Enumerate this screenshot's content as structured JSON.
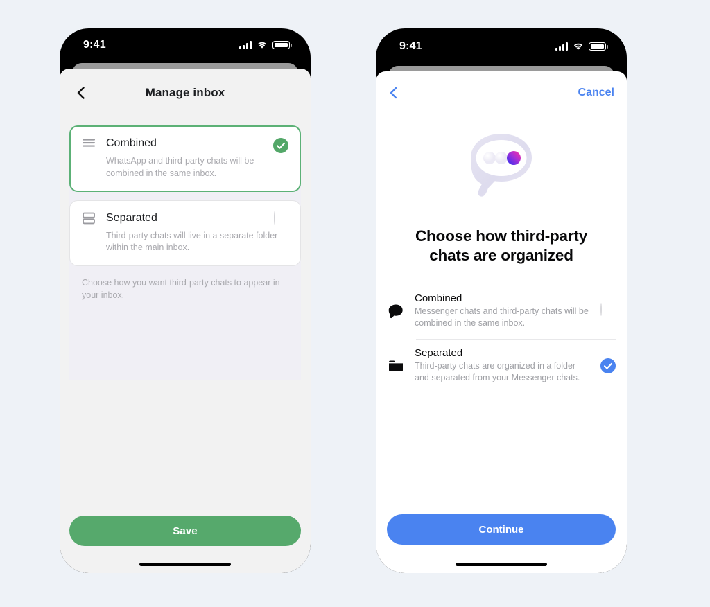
{
  "theme": {
    "page_bg": "#eef2f7",
    "green": "#56a96c",
    "green_border": "#5cb176",
    "blue": "#4a83f0",
    "muted_text": "#a9a9ae",
    "title_text": "#1c1e21"
  },
  "left_phone": {
    "status_bar": {
      "time": "9:41",
      "signal_icon": "cellular-bars-icon",
      "wifi_icon": "wifi-icon",
      "battery_icon": "battery-full-icon"
    },
    "nav": {
      "back_icon": "chevron-left-icon",
      "title": "Manage inbox"
    },
    "options": [
      {
        "icon": "list-lines-icon",
        "title": "Combined",
        "description": "WhatsApp and third-party chats will be combined in the same inbox.",
        "selected": true,
        "mark_icon": "check-circle-filled-icon"
      },
      {
        "icon": "stacked-boxes-icon",
        "title": "Separated",
        "description": "Third-party chats will live in a separate folder within the main inbox.",
        "selected": false,
        "mark_icon": "radio-empty-icon"
      }
    ],
    "helper_text": "Choose how you want third-party chats to appear in your inbox.",
    "primary_button": "Save",
    "home_indicator": "home-indicator"
  },
  "right_phone": {
    "status_bar": {
      "time": "9:41",
      "signal_icon": "cellular-bars-icon",
      "wifi_icon": "wifi-icon",
      "battery_icon": "battery-full-icon"
    },
    "nav": {
      "back_icon": "chevron-left-icon",
      "cancel_label": "Cancel"
    },
    "illustration": {
      "name": "chat-bubble-typing-illustration",
      "dot_gradient_from": "#ff2fa0",
      "dot_gradient_to": "#3a2ff0"
    },
    "heading": "Choose how third-party chats are organized",
    "options": [
      {
        "icon": "chat-bubble-icon",
        "title": "Combined",
        "description": "Messenger chats and third-party chats will be combined in the same inbox.",
        "selected": false,
        "mark_icon": "radio-empty-icon"
      },
      {
        "icon": "folder-icon",
        "title": "Separated",
        "description": "Third-party chats are organized in a folder and separated from your Messenger chats.",
        "selected": true,
        "mark_icon": "check-circle-filled-blue-icon"
      }
    ],
    "primary_button": "Continue",
    "home_indicator": "home-indicator"
  }
}
